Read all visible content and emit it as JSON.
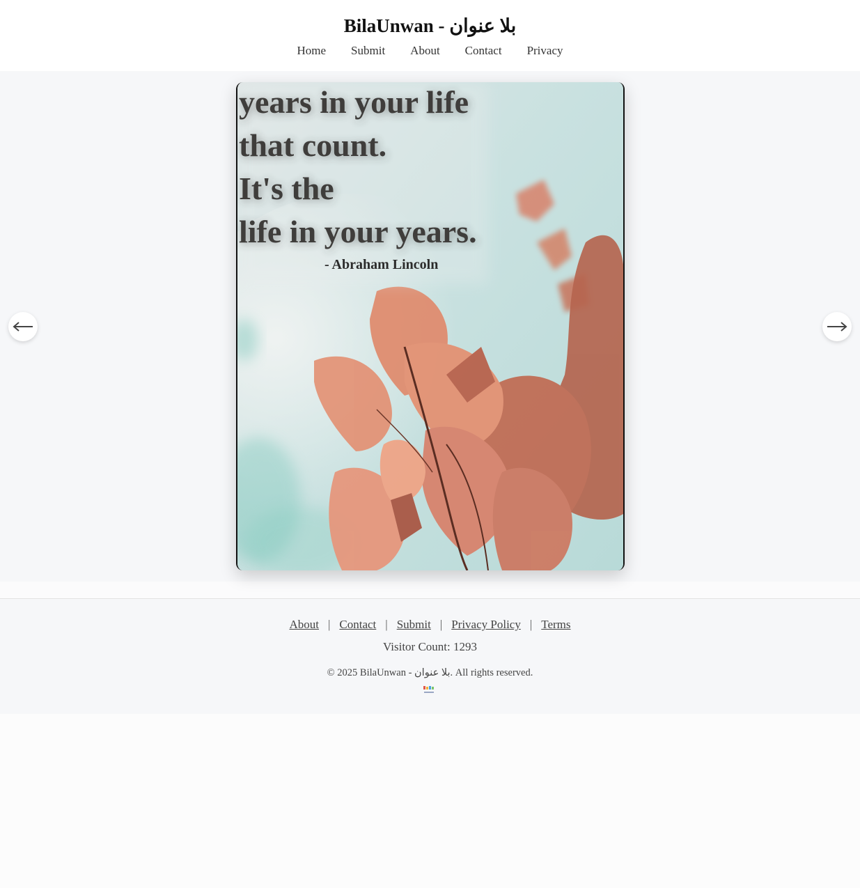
{
  "header": {
    "title": "BilaUnwan - بلا عنوان",
    "nav": [
      "Home",
      "Submit",
      "About",
      "Contact",
      "Privacy"
    ]
  },
  "slide": {
    "quote_lines": [
      "years in your life",
      "that count.",
      "It's the",
      "life in your years."
    ],
    "attribution": "- Abraham Lincoln"
  },
  "carousel": {
    "prev_icon": "arrow-left-icon",
    "next_icon": "arrow-right-icon"
  },
  "footer": {
    "links": [
      "About",
      "Contact",
      "Submit",
      "Privacy Policy",
      "Terms"
    ],
    "separator": "|",
    "visitor_count": "Visitor Count: 1293",
    "copyright": "© 2025 BilaUnwan - بلا عنوان. All rights reserved."
  }
}
